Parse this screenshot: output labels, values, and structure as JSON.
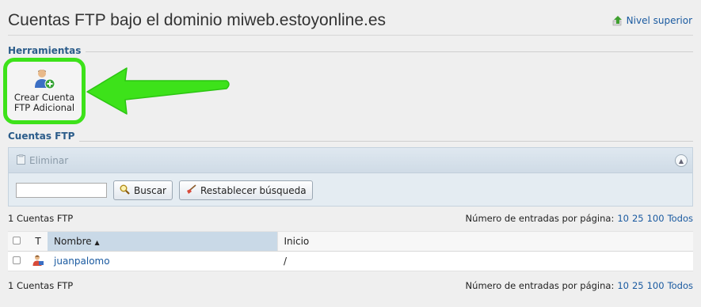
{
  "page": {
    "title": "Cuentas FTP bajo el dominio miweb.estoyonline.es",
    "up_link": "Nivel superior"
  },
  "tools": {
    "section_label": "Herramientas",
    "create_line1": "Crear Cuenta",
    "create_line2": "FTP Adicional"
  },
  "accounts": {
    "section_label": "Cuentas FTP",
    "panel_title": "Eliminar",
    "search_value": "",
    "search_button": "Buscar",
    "reset_button": "Restablecer búsqueda",
    "count_top": "1 Cuentas FTP",
    "count_bottom": "1 Cuentas FTP",
    "per_page_label": "Número de entradas por página:",
    "per_page_options": [
      "10",
      "25",
      "100",
      "Todos"
    ],
    "columns": {
      "type": "T",
      "name": "Nombre",
      "home": "Inicio"
    },
    "rows": [
      {
        "name": "juanpalomo",
        "home": "/"
      }
    ]
  },
  "colors": {
    "highlight": "#3de21a",
    "link": "#1a5aa0",
    "section": "#2b5c8a"
  },
  "icons": [
    "arrow-up-icon",
    "user-add-icon",
    "clipboard-icon",
    "collapse-icon",
    "magnifier-icon",
    "broom-icon",
    "user-icon"
  ]
}
